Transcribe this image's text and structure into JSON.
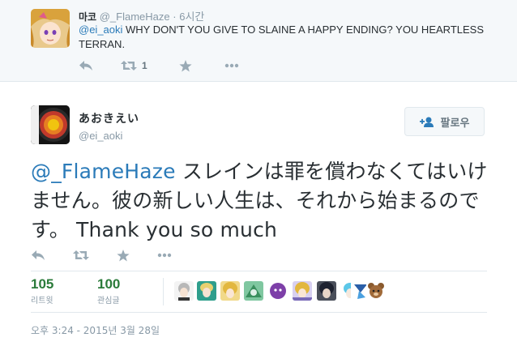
{
  "reply_tweet": {
    "name": "마코",
    "handle": "@_FlameHaze",
    "separator": "·",
    "time": "6시간",
    "mention": "@ei_aoki",
    "text": " WHY DON'T YOU GIVE TO SLAINE A HAPPY ENDING? YOU HEARTLESS TERRAN.",
    "retweet_count": "1",
    "actions": [
      "reply-icon",
      "retweet-icon",
      "favorite-icon",
      "more-icon"
    ]
  },
  "main_tweet": {
    "name": "あおきえい",
    "handle": "@ei_aoki",
    "follow_label": "팔로우",
    "mention": "@_FlameHaze",
    "text": " スレインは罪を償わなくてはいけません。彼の新しい人生は、それから始まるのです。 Thank you so much",
    "retweets": {
      "value": "105",
      "label": "리트윗"
    },
    "favorites": {
      "value": "100",
      "label": "관심글"
    },
    "timestamp": "오후 3:24 - 2015년 3월 28일",
    "liker_avatars": [
      "avatar-1",
      "avatar-2",
      "avatar-3",
      "avatar-4",
      "avatar-5",
      "avatar-6",
      "avatar-7",
      "avatar-8",
      "avatar-9",
      "avatar-10"
    ]
  },
  "colors": {
    "link": "#2b7bb9",
    "stat_number": "#2b7b3a",
    "muted": "#8899a6",
    "icon": "#99aab5",
    "reply_bg": "#f5f8fa"
  }
}
